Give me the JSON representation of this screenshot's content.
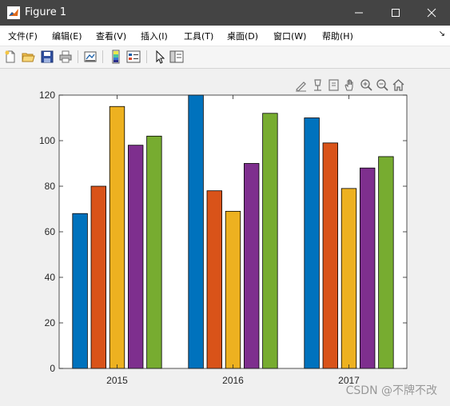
{
  "window": {
    "title": "Figure 1"
  },
  "menu": {
    "items": [
      "文件(F)",
      "编辑(E)",
      "查看(V)",
      "插入(I)",
      "工具(T)",
      "桌面(D)",
      "窗口(W)",
      "帮助(H)"
    ],
    "overflow_icon": "arrow-icon"
  },
  "toolbar": {
    "icons": [
      "new-figure-icon",
      "open-file-icon",
      "save-icon",
      "print-icon",
      "link-plot-icon",
      "colorbar-icon",
      "legend-icon",
      "edit-plot-icon",
      "property-inspector-icon"
    ]
  },
  "axes_toolbar": {
    "icons": [
      "brush-icon",
      "data-tips-icon",
      "export-icon",
      "pan-icon",
      "zoom-in-icon",
      "zoom-out-icon",
      "home-icon"
    ]
  },
  "chart_data": {
    "type": "bar",
    "categories": [
      "2015",
      "2016",
      "2017"
    ],
    "series": [
      {
        "color": "#0072BD",
        "values": [
          68,
          120,
          110
        ]
      },
      {
        "color": "#D95319",
        "values": [
          80,
          78,
          99
        ]
      },
      {
        "color": "#EDB120",
        "values": [
          115,
          69,
          79
        ]
      },
      {
        "color": "#7E2F8E",
        "values": [
          98,
          90,
          88
        ]
      },
      {
        "color": "#77AC30",
        "values": [
          102,
          112,
          93
        ]
      }
    ],
    "ylim": [
      0,
      120
    ],
    "yticks": [
      "0",
      "20",
      "40",
      "60",
      "80",
      "100",
      "120"
    ],
    "grid": false,
    "legend": "none"
  },
  "watermark": "CSDN @不牌不改"
}
